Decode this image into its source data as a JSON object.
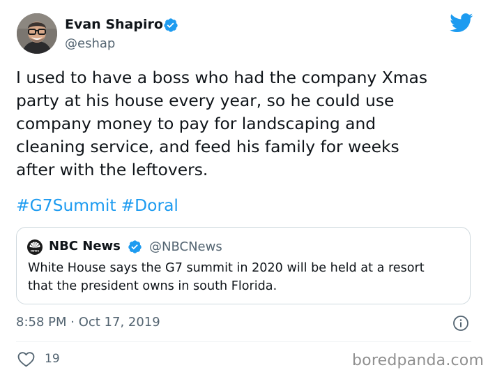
{
  "author": {
    "name": "Evan Shapiro",
    "handle": "@eshap",
    "verified": true
  },
  "tweet": {
    "text": "I used to have a boss who had the company Xmas\nparty at his house every year, so he could use\ncompany money to pay for landscaping and\ncleaning service, and feed his family for weeks\nafter with the leftovers.",
    "hashtags": [
      "#G7Summit",
      "#Doral"
    ],
    "timestamp": "8:58 PM · Oct 17, 2019",
    "like_count": "19"
  },
  "quoted": {
    "name": "NBC News",
    "handle": "@NBCNews",
    "verified": true,
    "text": "White House says the G7 summit in 2020 will be held at a resort\nthat the president owns in south Florida."
  },
  "watermark": "boredpanda.com",
  "colors": {
    "accent": "#1d9bf0",
    "secondary_text": "#536471",
    "border": "#cfd9de"
  },
  "icons": [
    "verified-icon",
    "twitter-bird-icon",
    "nbc-peacock-icon",
    "info-icon",
    "heart-icon"
  ]
}
